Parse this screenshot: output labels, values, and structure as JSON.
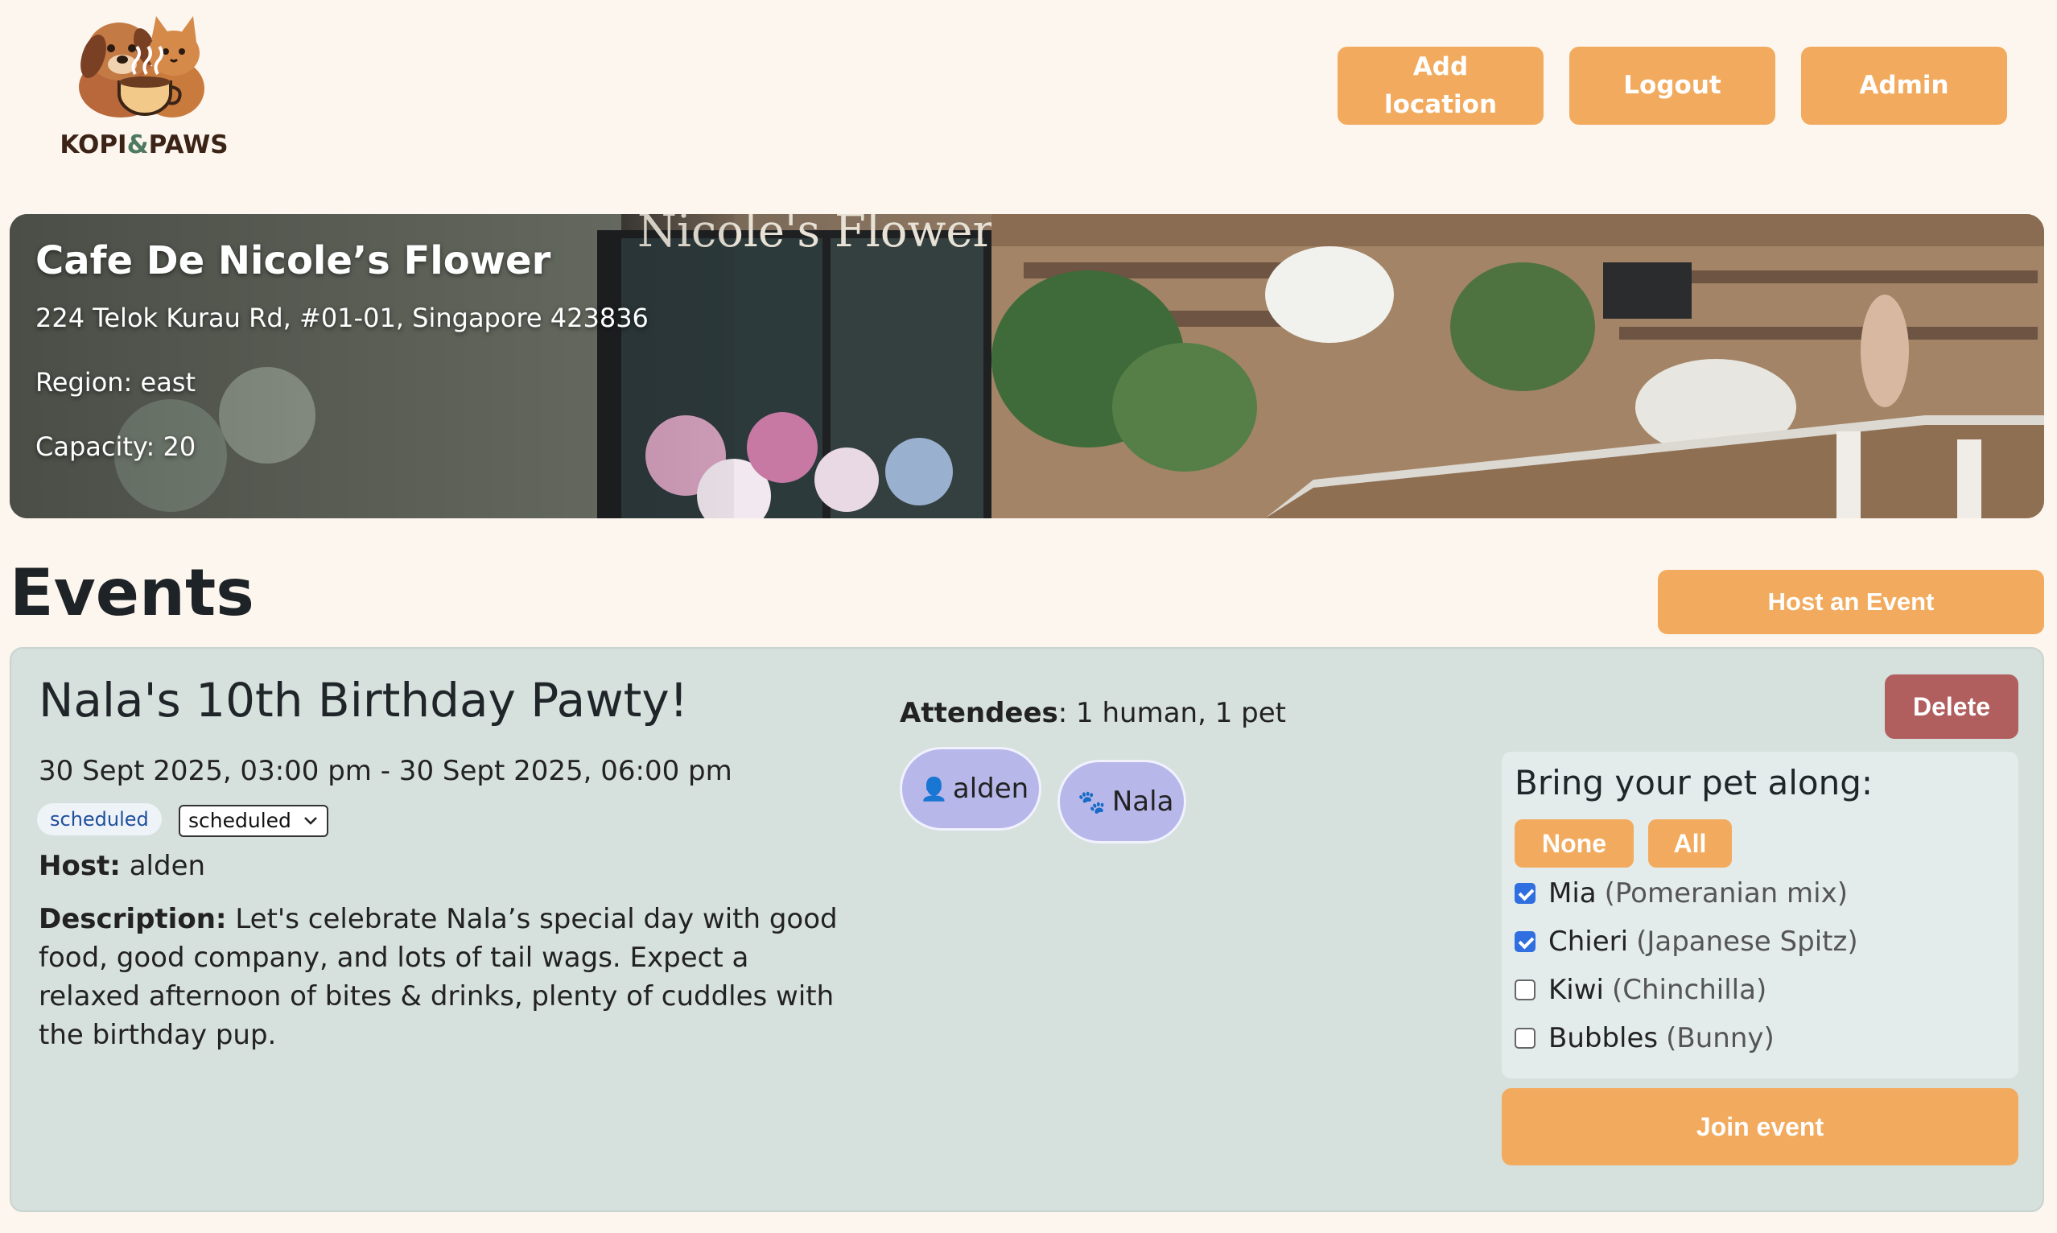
{
  "brand": {
    "logo_text_left": "KOPI",
    "logo_text_amp": "&",
    "logo_text_right": "PAWS"
  },
  "header": {
    "add_location_label": "Add location",
    "logout_label": "Logout",
    "admin_label": "Admin"
  },
  "location": {
    "name": "Cafe De Nicole’s Flower",
    "address": "224 Telok Kurau Rd, #01-01, Singapore 423836",
    "region": "Region: east",
    "capacity": "Capacity: 20",
    "sign_text": "Nicole's Flower"
  },
  "events_section": {
    "title": "Events",
    "host_button_label": "Host an Event"
  },
  "event": {
    "title": "Nala's 10th Birthday Pawty!",
    "time_range": "30 Sept 2025, 03:00 pm - 30 Sept 2025, 06:00 pm",
    "status_badge": "scheduled",
    "status_select_value": "scheduled",
    "host_label": "Host:",
    "host_value": "alden",
    "description_label": "Description:",
    "description_text": "Let's celebrate Nala’s special day with good food, good company, and lots of tail wags. Expect a relaxed afternoon of bites & drinks, plenty of cuddles with the birthday pup.",
    "attendees_label": "Attendees",
    "attendees_summary": ": 1 human, 1 pet",
    "attendees": [
      {
        "icon": "person-icon",
        "glyph": "👤",
        "name": "alden"
      },
      {
        "icon": "paw-icon",
        "glyph": "🐾",
        "name": "Nala"
      }
    ],
    "delete_label": "Delete"
  },
  "pets_panel": {
    "title": "Bring your pet along:",
    "none_label": "None",
    "all_label": "All",
    "pets": [
      {
        "name": "Mia",
        "breed": "(Pomeranian mix)",
        "checked": true
      },
      {
        "name": "Chieri",
        "breed": "(Japanese Spitz)",
        "checked": true
      },
      {
        "name": "Kiwi",
        "breed": "(Chinchilla)",
        "checked": false
      },
      {
        "name": "Bubbles",
        "breed": "(Bunny)",
        "checked": false
      }
    ],
    "join_label": "Join event"
  },
  "colors": {
    "page_bg": "#fdf6ef",
    "accent_orange": "#f2ab5e",
    "delete_red": "#b05e5e",
    "card_bg": "#d6e0dc",
    "chip_purple": "#b7b7ea",
    "checkbox_blue": "#2f6fdf"
  }
}
